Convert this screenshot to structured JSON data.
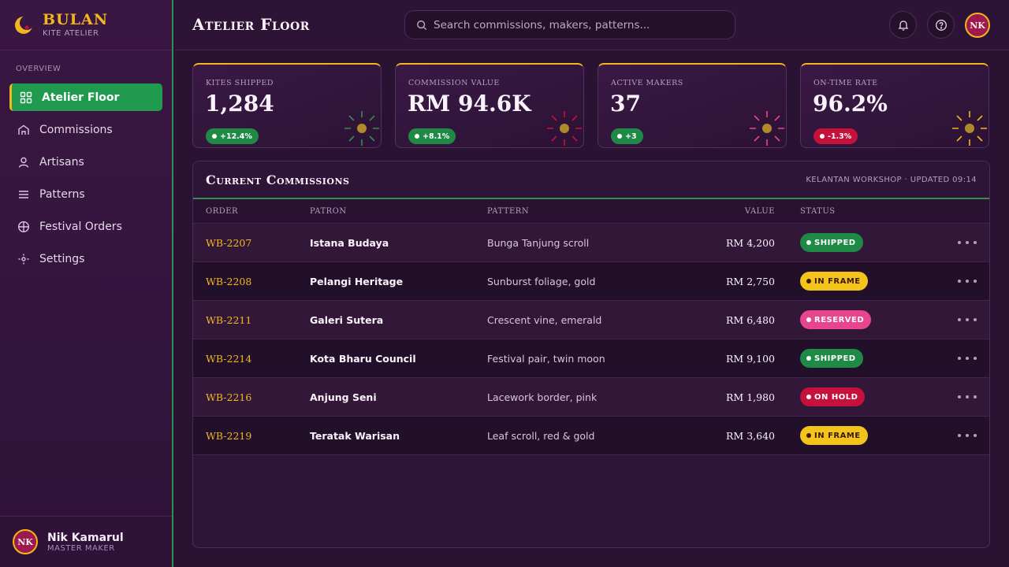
{
  "brand": {
    "name": "BULAN",
    "subtitle": "KITE ATELIER"
  },
  "sidebar": {
    "section": "OVERVIEW",
    "items": [
      {
        "label": "Atelier Floor",
        "icon": "grid-icon",
        "active": true
      },
      {
        "label": "Commissions",
        "icon": "home-icon"
      },
      {
        "label": "Artisans",
        "icon": "user-icon"
      },
      {
        "label": "Patterns",
        "icon": "menu-icon"
      },
      {
        "label": "Festival Orders",
        "icon": "globe-icon"
      },
      {
        "label": "Settings",
        "icon": "gear-icon"
      }
    ],
    "user": {
      "initials": "NK",
      "name": "Nik Kamarul",
      "role": "MASTER MAKER"
    }
  },
  "header": {
    "title": "Atelier Floor",
    "search_placeholder": "Search commissions, makers, patterns...",
    "avatar_initials": "NK"
  },
  "kpis": [
    {
      "label": "Kites Shipped",
      "value": "1,284",
      "delta": "+12.4%",
      "trend": "up",
      "accent": "#2f8f4e"
    },
    {
      "label": "Commission Value",
      "value": "RM 94.6K",
      "delta": "+8.1%",
      "trend": "up",
      "accent": "#c4123c"
    },
    {
      "label": "Active Makers",
      "value": "37",
      "delta": "+3",
      "trend": "up",
      "accent": "#e8458f"
    },
    {
      "label": "On-Time Rate",
      "value": "96.2%",
      "delta": "-1.3%",
      "trend": "down",
      "accent": "#f2b71c"
    }
  ],
  "commissions": {
    "title": "Current Commissions",
    "meta": "KELANTAN WORKSHOP · UPDATED 09:14",
    "columns": {
      "order": "Order",
      "patron": "Patron",
      "pattern": "Pattern",
      "value": "Value",
      "status": "Status"
    },
    "rows": [
      {
        "order": "WB-2207",
        "patron": "Istana Budaya",
        "pattern": "Bunga Tanjung scroll",
        "value": "RM 4,200",
        "status": "SHIPPED",
        "status_kind": "shipped"
      },
      {
        "order": "WB-2208",
        "patron": "Pelangi Heritage",
        "pattern": "Sunburst foliage, gold",
        "value": "RM 2,750",
        "status": "IN FRAME",
        "status_kind": "frame"
      },
      {
        "order": "WB-2211",
        "patron": "Galeri Sutera",
        "pattern": "Crescent vine, emerald",
        "value": "RM 6,480",
        "status": "RESERVED",
        "status_kind": "reserved"
      },
      {
        "order": "WB-2214",
        "patron": "Kota Bharu Council",
        "pattern": "Festival pair, twin moon",
        "value": "RM 9,100",
        "status": "SHIPPED",
        "status_kind": "shipped"
      },
      {
        "order": "WB-2216",
        "patron": "Anjung Seni",
        "pattern": "Lacework border, pink",
        "value": "RM 1,980",
        "status": "ON HOLD",
        "status_kind": "hold"
      },
      {
        "order": "WB-2219",
        "patron": "Teratak Warisan",
        "pattern": "Leaf scroll, red & gold",
        "value": "RM 3,640",
        "status": "IN FRAME",
        "status_kind": "frame"
      }
    ]
  },
  "colors": {
    "accent_gold": "#f2b71c",
    "accent_green": "#1f9a4e",
    "background": "#2a1233",
    "status_shipped": "#1f8a45",
    "status_frame": "#f2c41c",
    "status_reserved": "#e8458f",
    "status_hold": "#c4123c"
  }
}
